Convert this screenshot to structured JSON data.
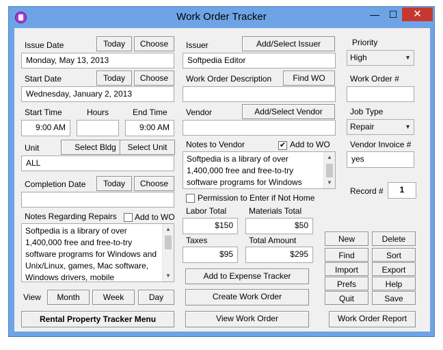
{
  "window": {
    "title": "Work Order Tracker",
    "min": "—",
    "max": "☐",
    "close": "✕"
  },
  "left": {
    "issue_date_label": "Issue Date",
    "issue_date_value": "Monday, May 13, 2013",
    "start_date_label": "Start Date",
    "start_date_value": "Wednesday, January 2, 2013",
    "today_label": "Today",
    "choose_label": "Choose",
    "start_time_label": "Start Time",
    "hours_label": "Hours",
    "end_time_label": "End Time",
    "start_time_value": "9:00 AM",
    "hours_value": "",
    "end_time_value": "9:00 AM",
    "unit_label": "Unit",
    "select_bldg_label": "Select Bldg",
    "select_unit_label": "Select Unit",
    "unit_value": "ALL",
    "completion_date_label": "Completion Date",
    "completion_date_value": "",
    "notes_label": "Notes Regarding Repairs",
    "add_to_wo_label": "Add to WO",
    "notes_text": "Softpedia is a library of over 1,400,000 free and free-to-try software programs for Windows and Unix/Linux, games, Mac software, Windows drivers, mobile",
    "view_label": "View",
    "month_label": "Month",
    "week_label": "Week",
    "day_label": "Day",
    "rental_menu_label": "Rental Property Tracker Menu"
  },
  "middle": {
    "issuer_label": "Issuer",
    "add_issuer_label": "Add/Select Issuer",
    "issuer_value": "Softpedia Editor",
    "wo_desc_label": "Work Order Description",
    "find_wo_label": "Find WO",
    "wo_desc_value": "",
    "vendor_label": "Vendor",
    "add_vendor_label": "Add/Select Vendor",
    "vendor_value": "",
    "notes_vendor_label": "Notes to Vendor",
    "add_to_wo_label": "Add to WO",
    "add_to_wo_checked": "✔",
    "notes_vendor_text": "Softpedia is a library of over 1,400,000 free and free-to-try software programs for Windows",
    "permission_label": "Permission to Enter if Not Home",
    "labor_total_label": "Labor Total",
    "labor_total_value": "$150",
    "materials_total_label": "Materials Total",
    "materials_total_value": "$50",
    "taxes_label": "Taxes",
    "taxes_value": "$95",
    "total_amount_label": "Total Amount",
    "total_amount_value": "$295",
    "add_expense_label": "Add to Expense Tracker",
    "create_wo_label": "Create Work Order",
    "view_wo_label": "View Work Order"
  },
  "right": {
    "priority_label": "Priority",
    "priority_value": "High",
    "wo_number_label": "Work Order #",
    "wo_number_value": "",
    "job_type_label": "Job Type",
    "job_type_value": "Repair",
    "vendor_invoice_label": "Vendor Invoice #",
    "vendor_invoice_value": "yes",
    "record_label": "Record #",
    "record_value": "1",
    "new_label": "New",
    "delete_label": "Delete",
    "find_label": "Find",
    "sort_label": "Sort",
    "import_label": "Import",
    "export_label": "Export",
    "prefs_label": "Prefs",
    "help_label": "Help",
    "quit_label": "Quit",
    "save_label": "Save",
    "wo_report_label": "Work Order Report"
  }
}
